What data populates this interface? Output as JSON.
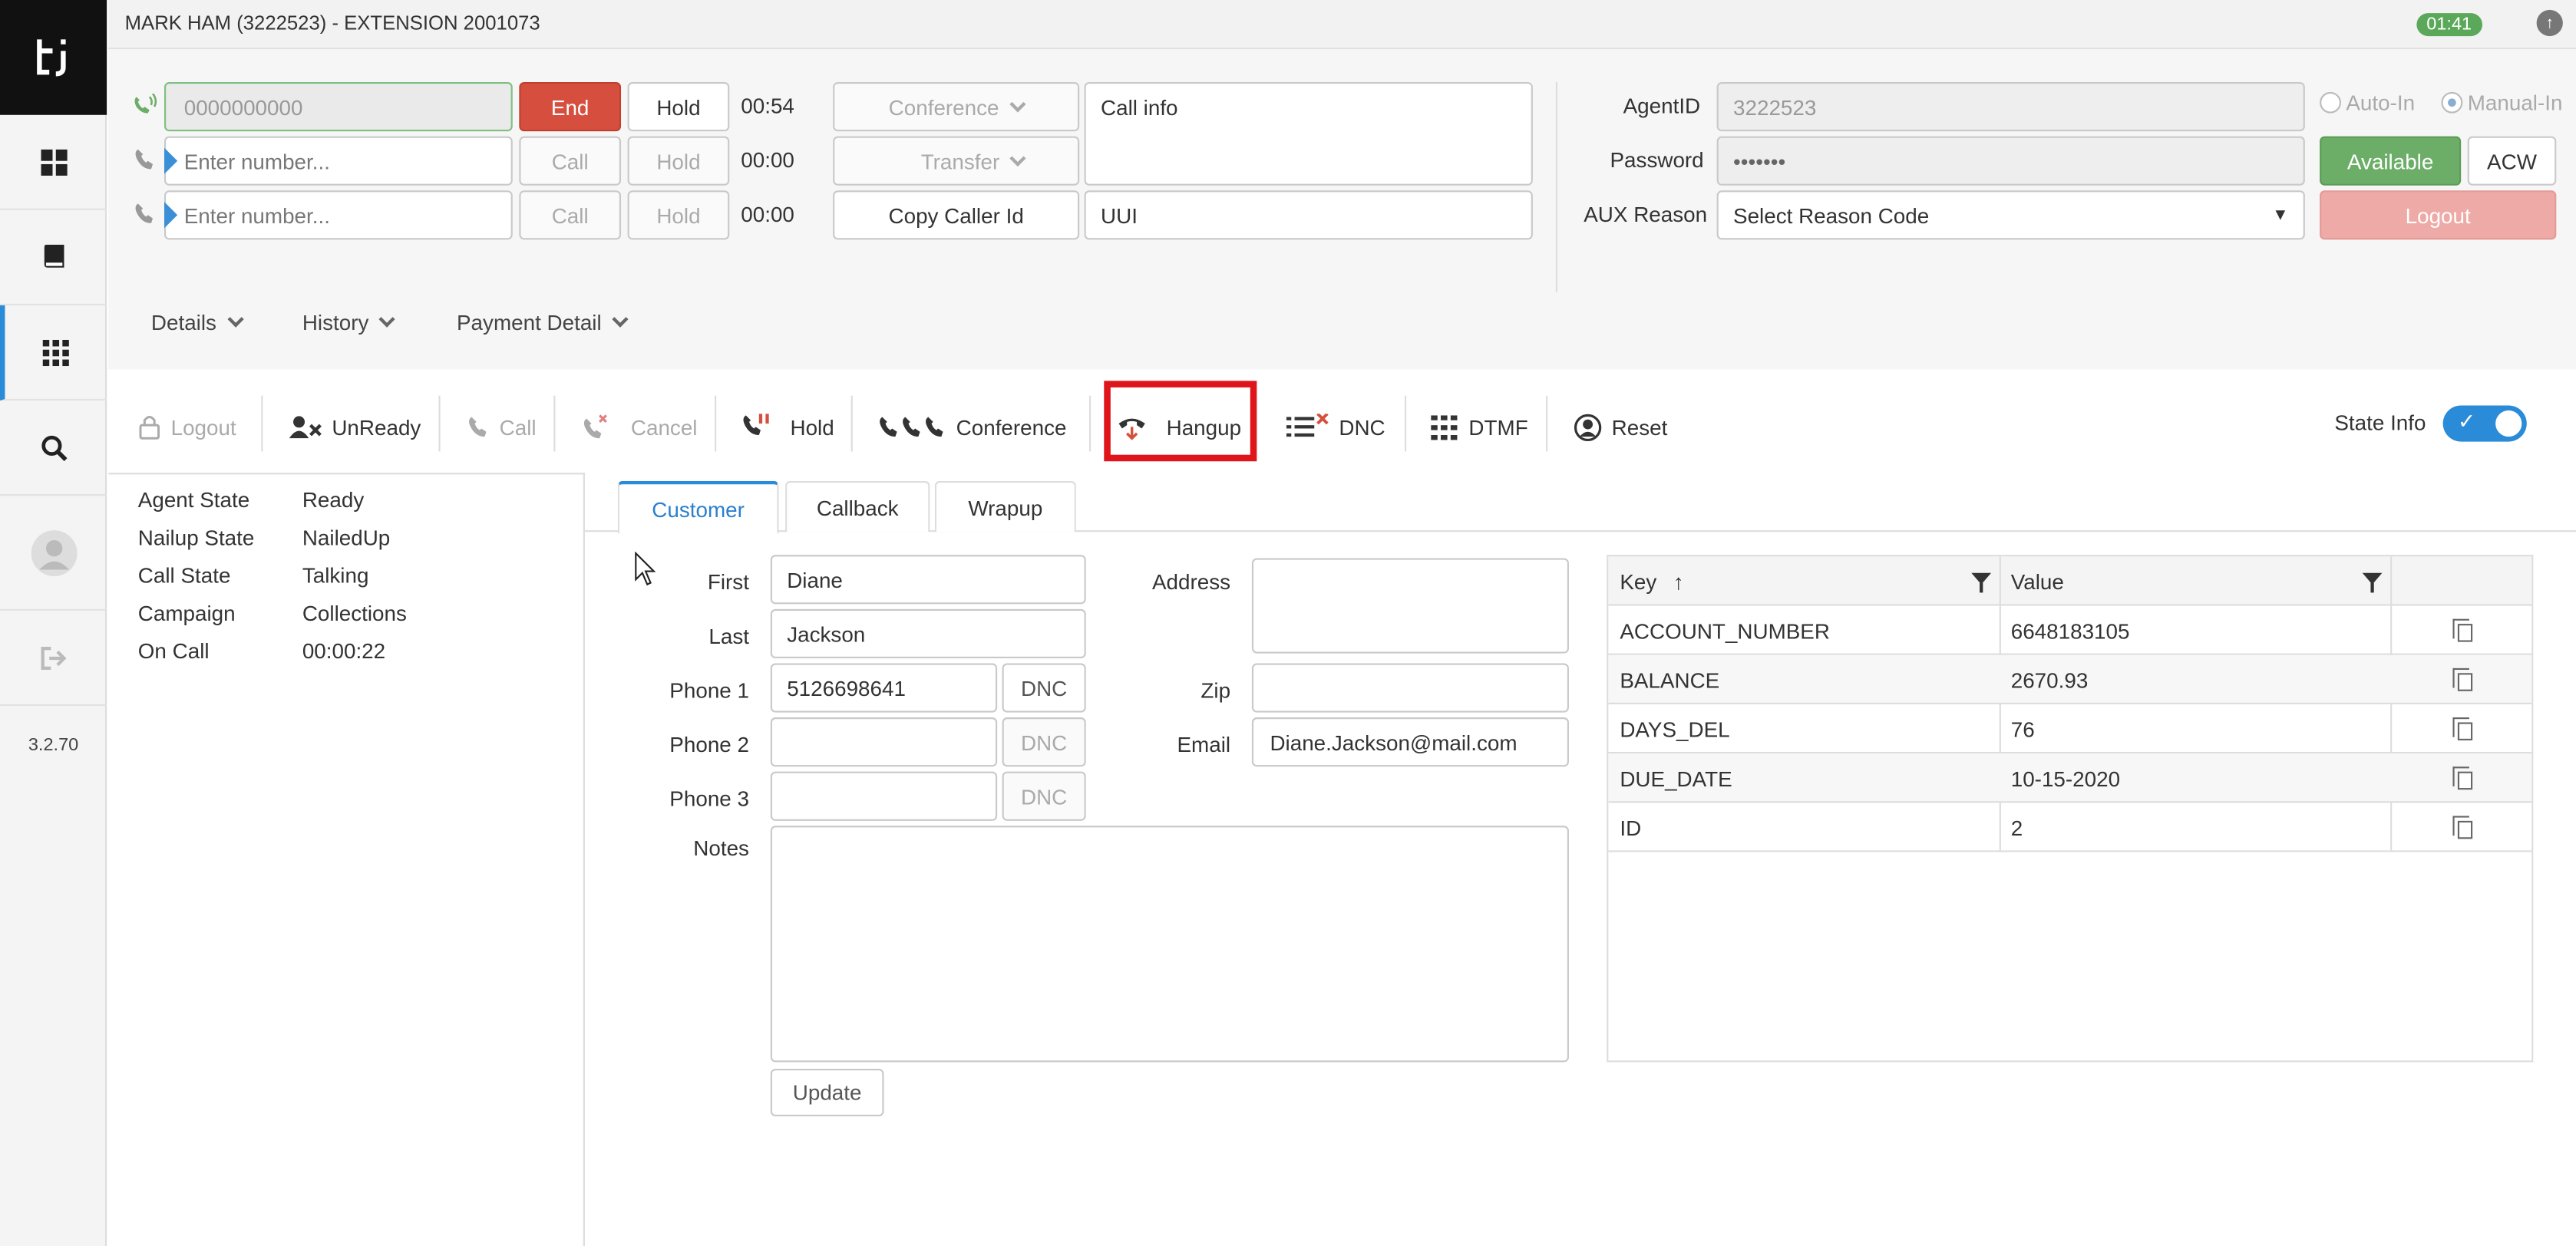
{
  "app": {
    "title": "MARK HAM (3222523) - EXTENSION 2001073",
    "timer": "01:41",
    "version": "3.2.70",
    "logo_text": "ti"
  },
  "sidebar": {
    "items": [
      {
        "icon": "dashboard-icon"
      },
      {
        "icon": "book-icon"
      },
      {
        "icon": "grid-icon",
        "active": true
      },
      {
        "icon": "search-icon"
      },
      {
        "icon": "user-avatar-icon"
      },
      {
        "icon": "sign-out-icon"
      }
    ]
  },
  "lines": [
    {
      "value": "",
      "placeholder": "0000000000",
      "action": "End",
      "hold": "Hold",
      "time": "00:54"
    },
    {
      "value": "",
      "placeholder": "Enter number...",
      "action": "Call",
      "hold": "Hold",
      "time": "00:00"
    },
    {
      "value": "",
      "placeholder": "Enter number...",
      "action": "Call",
      "hold": "Hold",
      "time": "00:00"
    }
  ],
  "call_controls": {
    "conference": "Conference",
    "transfer": "Transfer",
    "copy_caller_id": "Copy Caller Id",
    "call_info": "Call info",
    "uui": "UUI"
  },
  "agent": {
    "agent_id_label": "AgentID",
    "agent_id_value": "3222523",
    "password_label": "Password",
    "password_value": "•••••••",
    "aux_label": "AUX Reason",
    "aux_value": "Select Reason Code",
    "auto_in": "Auto-In",
    "manual_in": "Manual-In",
    "available": "Available",
    "acw": "ACW",
    "logout": "Logout"
  },
  "menus": {
    "details": "Details",
    "history": "History",
    "payment": "Payment Detail"
  },
  "toolbar": {
    "logout": "Logout",
    "unready": "UnReady",
    "call": "Call",
    "cancel": "Cancel",
    "hold": "Hold",
    "conference": "Conference",
    "hangup": "Hangup",
    "dnc": "DNC",
    "dtmf": "DTMF",
    "reset": "Reset",
    "state_info": "State Info"
  },
  "state": [
    {
      "label": "Agent State",
      "value": "Ready"
    },
    {
      "label": "Nailup State",
      "value": "NailedUp"
    },
    {
      "label": "Call State",
      "value": "Talking"
    },
    {
      "label": "Campaign",
      "value": "Collections"
    },
    {
      "label": "On Call",
      "value": "00:00:22"
    }
  ],
  "tabs": [
    "Customer",
    "Callback",
    "Wrapup"
  ],
  "customer": {
    "first_label": "First",
    "first": "Diane",
    "last_label": "Last",
    "last": "Jackson",
    "phone1_label": "Phone 1",
    "phone1": "5126698641",
    "phone2_label": "Phone 2",
    "phone2": "",
    "phone3_label": "Phone 3",
    "phone3": "",
    "dnc": "DNC",
    "notes_label": "Notes",
    "notes": "",
    "address_label": "Address",
    "address": "",
    "zip_label": "Zip",
    "zip": "",
    "email_label": "Email",
    "email": "Diane.Jackson@mail.com",
    "update": "Update"
  },
  "kv_table": {
    "headers": {
      "key": "Key",
      "value": "Value",
      "sort": "↑"
    },
    "rows": [
      {
        "key": "ACCOUNT_NUMBER",
        "value": "6648183105"
      },
      {
        "key": "BALANCE",
        "value": "2670.93"
      },
      {
        "key": "DAYS_DEL",
        "value": "76"
      },
      {
        "key": "DUE_DATE",
        "value": "10-15-2020"
      },
      {
        "key": "ID",
        "value": "2"
      }
    ]
  },
  "colors": {
    "accent": "#2a8bd8",
    "end_red": "#d64f3e",
    "available_green": "#6cae68",
    "highlight": "#e0141b"
  }
}
